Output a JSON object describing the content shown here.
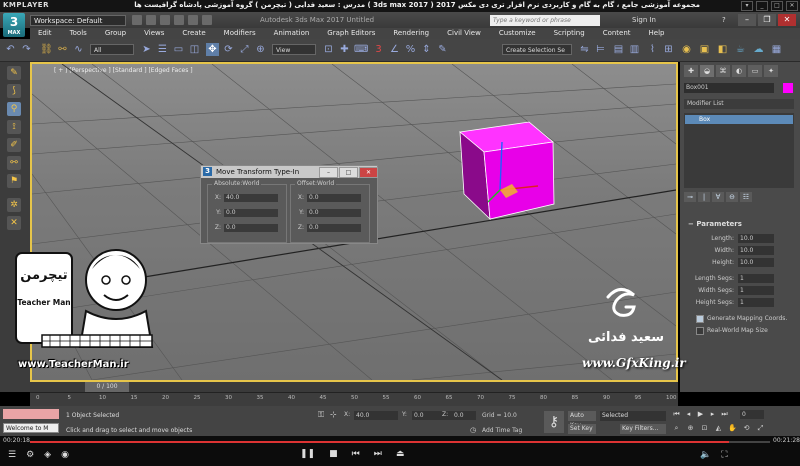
{
  "player": {
    "brand": "KMPLAYER",
    "title": "مجموعه آموزشی جامع ، گام به گام و کاربردی نرم افزار تری دی مکس 2017 ( 3ds max 2017 )   مدرس : سعید فدایی ( تیچرمن ) گروه آموزشی پادشاه گرافیست ها",
    "current_time": "00:20:18",
    "total_time": "00:21:28",
    "progress": 0.945
  },
  "app": {
    "logo_number": "3",
    "logo_text": "MAX",
    "workspace": "Workspace: Default",
    "title": "Autodesk 3ds Max 2017     Untitled",
    "search_placeholder": "Type a keyword or phrase",
    "sign_in": "Sign In",
    "help": "?"
  },
  "menu": [
    "Edit",
    "Tools",
    "Group",
    "Views",
    "Create",
    "Modifiers",
    "Animation",
    "Graph Editors",
    "Rendering",
    "Civil View",
    "Customize",
    "Scripting",
    "Content",
    "Help"
  ],
  "toolbar": {
    "filter_dropdown": "All",
    "refcoord_dropdown": "View",
    "selection_set": "Create Selection Se"
  },
  "viewport": {
    "label": "[ + ] [Perspective ] [Standard ] [Edged Faces ]",
    "object_color": "#ff00ff"
  },
  "dialog": {
    "title": "Move Transform Type-In",
    "absolute_title": "Absolute:World",
    "offset_title": "Offset:World",
    "absolute": [
      {
        "axis": "X:",
        "value": "40.0"
      },
      {
        "axis": "Y:",
        "value": "0.0"
      },
      {
        "axis": "Z:",
        "value": "0.0"
      }
    ],
    "offset": [
      {
        "axis": "X:",
        "value": "0.0"
      },
      {
        "axis": "Y:",
        "value": "0.0"
      },
      {
        "axis": "Z:",
        "value": "0.0"
      }
    ]
  },
  "command_panel": {
    "object_name": "Box001",
    "modifier_list": "Modifier List",
    "stack_item": "Box",
    "parameters_title": "Parameters",
    "params": [
      {
        "label": "Length:",
        "value": "10.0"
      },
      {
        "label": "Width:",
        "value": "10.0"
      },
      {
        "label": "Height:",
        "value": "10.0"
      },
      {
        "label": "Length Segs:",
        "value": "1"
      },
      {
        "label": "Width Segs:",
        "value": "1"
      },
      {
        "label": "Height Segs:",
        "value": "1"
      }
    ],
    "generate_mapping": "Generate Mapping Coords.",
    "real_world": "Real-World Map Size"
  },
  "timeline": {
    "slider_label": "0 / 100",
    "ticks": [
      "0",
      "5",
      "10",
      "15",
      "20",
      "25",
      "30",
      "35",
      "40",
      "45",
      "50",
      "55",
      "60",
      "65",
      "70",
      "75",
      "80",
      "85",
      "90",
      "95",
      "100"
    ]
  },
  "status": {
    "maxscript": "Welcome to M",
    "selection": "1 Object Selected",
    "hint": "Click and drag to select and move objects",
    "x_label": "X:",
    "x_value": "40.0",
    "y_label": "Y:",
    "y_value": "0.0",
    "z_label": "Z:",
    "z_value": "0.0",
    "grid": "Grid = 10.0",
    "add_time_tag": "Add Time Tag",
    "auto_key": "Auto Key",
    "set_key": "Set Key",
    "selected": "Selected",
    "key_filters": "Key Filters...",
    "frame": "0"
  },
  "watermarks": {
    "teacher_brand": "تیچرمن",
    "teacher_name": "Teacher Man",
    "teacher_url": "www.TeacherMan.ir",
    "author_name": "سعید فدائی",
    "gfx_url": "www.GfxKing.ir"
  }
}
